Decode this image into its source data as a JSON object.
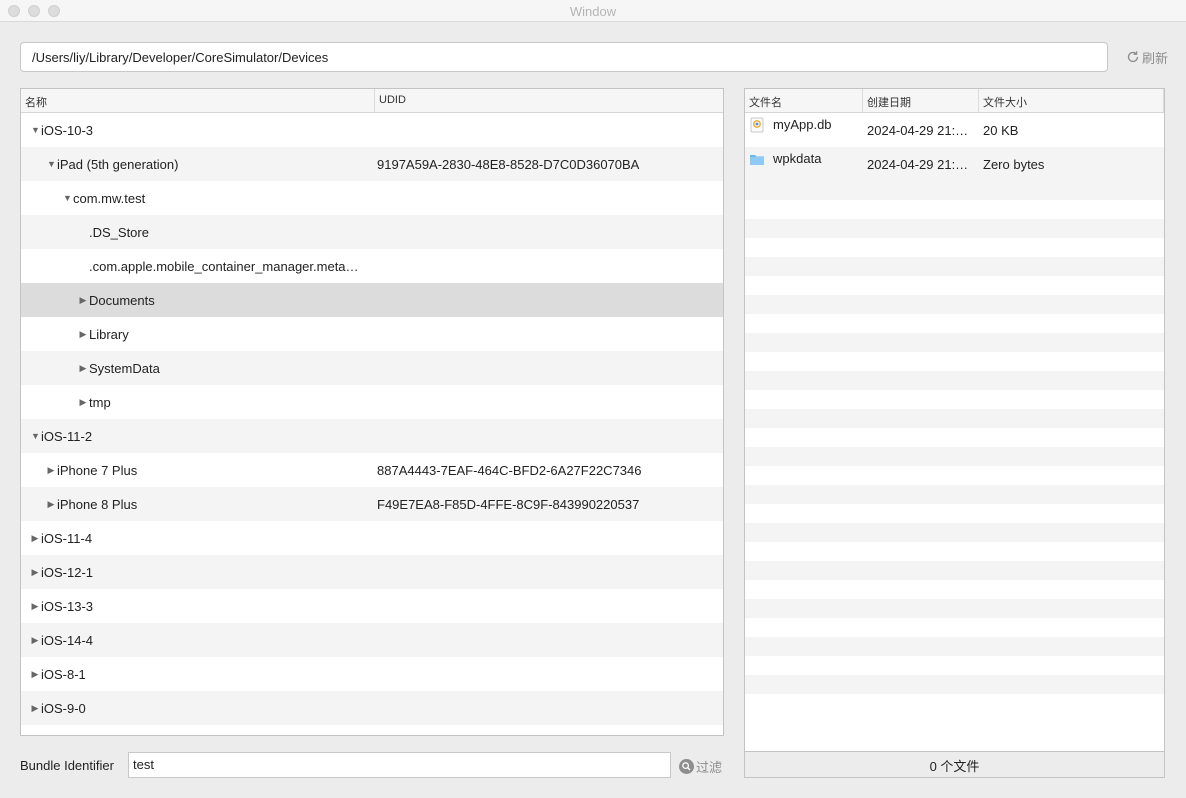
{
  "window": {
    "title": "Window"
  },
  "path": {
    "value": "/Users/liy/Library/Developer/CoreSimulator/Devices"
  },
  "refresh": {
    "label": "刷新"
  },
  "tree": {
    "headers": {
      "name": "名称",
      "udid": "UDID"
    },
    "rows": [
      {
        "label": "iOS-10-3",
        "udid": "",
        "arrow": "▼"
      },
      {
        "label": "iPad (5th generation)",
        "udid": "9197A59A-2830-48E8-8528-D7C0D36070BA",
        "arrow": "▼"
      },
      {
        "label": "com.mw.test",
        "udid": "",
        "arrow": "▼"
      },
      {
        "label": ".DS_Store",
        "udid": "",
        "arrow": ""
      },
      {
        "label": ".com.apple.mobile_container_manager.meta…",
        "udid": "",
        "arrow": ""
      },
      {
        "label": "Documents",
        "udid": "",
        "arrow": "▶"
      },
      {
        "label": "Library",
        "udid": "",
        "arrow": "▶"
      },
      {
        "label": "SystemData",
        "udid": "",
        "arrow": "▶"
      },
      {
        "label": "tmp",
        "udid": "",
        "arrow": "▶"
      },
      {
        "label": "iOS-11-2",
        "udid": "",
        "arrow": "▼"
      },
      {
        "label": "iPhone 7 Plus",
        "udid": "887A4443-7EAF-464C-BFD2-6A27F22C7346",
        "arrow": "▶"
      },
      {
        "label": "iPhone 8 Plus",
        "udid": "F49E7EA8-F85D-4FFE-8C9F-843990220537",
        "arrow": "▶"
      },
      {
        "label": "iOS-11-4",
        "udid": "",
        "arrow": "▶"
      },
      {
        "label": "iOS-12-1",
        "udid": "",
        "arrow": "▶"
      },
      {
        "label": "iOS-13-3",
        "udid": "",
        "arrow": "▶"
      },
      {
        "label": "iOS-14-4",
        "udid": "",
        "arrow": "▶"
      },
      {
        "label": "iOS-8-1",
        "udid": "",
        "arrow": "▶"
      },
      {
        "label": "iOS-9-0",
        "udid": "",
        "arrow": "▶"
      }
    ]
  },
  "files": {
    "headers": {
      "name": "文件名",
      "date": "创建日期",
      "size": "文件大小"
    },
    "rows": [
      {
        "name": "myApp.db",
        "date": "2024-04-29 21:…",
        "size": "20 KB",
        "icon": "database-file-icon"
      },
      {
        "name": "wpkdata",
        "date": "2024-04-29 21:…",
        "size": "Zero bytes",
        "icon": "folder-icon"
      }
    ]
  },
  "status": {
    "file_count": "0 个文件"
  },
  "bundle": {
    "label": "Bundle Identifier",
    "value": "test"
  },
  "filter": {
    "label": "过滤"
  },
  "colors": {
    "selection": "#dcdcdc",
    "stripe": "#f4f4f4",
    "folder": "#6ab8f0"
  }
}
